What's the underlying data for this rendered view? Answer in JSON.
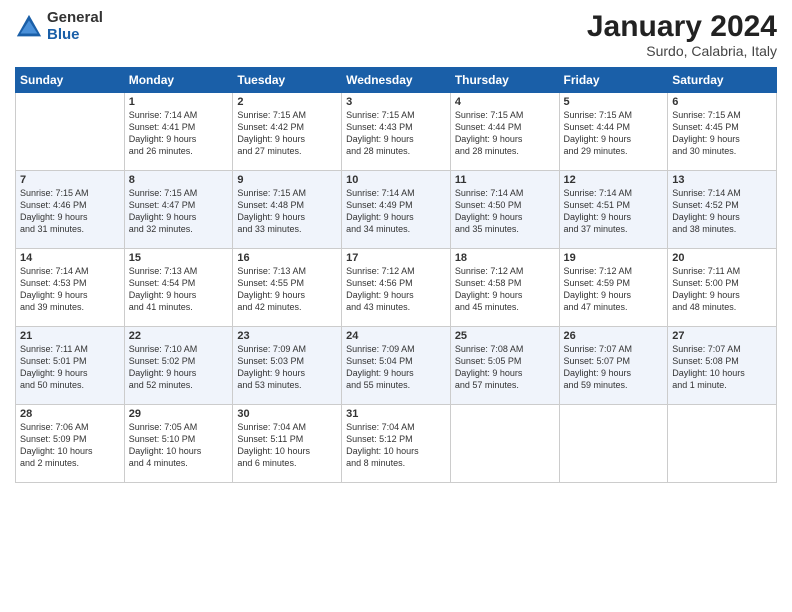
{
  "header": {
    "logo_general": "General",
    "logo_blue": "Blue",
    "title": "January 2024",
    "subtitle": "Surdo, Calabria, Italy"
  },
  "columns": [
    "Sunday",
    "Monday",
    "Tuesday",
    "Wednesday",
    "Thursday",
    "Friday",
    "Saturday"
  ],
  "weeks": [
    [
      {
        "day": "",
        "info": ""
      },
      {
        "day": "1",
        "info": "Sunrise: 7:14 AM\nSunset: 4:41 PM\nDaylight: 9 hours\nand 26 minutes."
      },
      {
        "day": "2",
        "info": "Sunrise: 7:15 AM\nSunset: 4:42 PM\nDaylight: 9 hours\nand 27 minutes."
      },
      {
        "day": "3",
        "info": "Sunrise: 7:15 AM\nSunset: 4:43 PM\nDaylight: 9 hours\nand 28 minutes."
      },
      {
        "day": "4",
        "info": "Sunrise: 7:15 AM\nSunset: 4:44 PM\nDaylight: 9 hours\nand 28 minutes."
      },
      {
        "day": "5",
        "info": "Sunrise: 7:15 AM\nSunset: 4:44 PM\nDaylight: 9 hours\nand 29 minutes."
      },
      {
        "day": "6",
        "info": "Sunrise: 7:15 AM\nSunset: 4:45 PM\nDaylight: 9 hours\nand 30 minutes."
      }
    ],
    [
      {
        "day": "7",
        "info": "Sunrise: 7:15 AM\nSunset: 4:46 PM\nDaylight: 9 hours\nand 31 minutes."
      },
      {
        "day": "8",
        "info": "Sunrise: 7:15 AM\nSunset: 4:47 PM\nDaylight: 9 hours\nand 32 minutes."
      },
      {
        "day": "9",
        "info": "Sunrise: 7:15 AM\nSunset: 4:48 PM\nDaylight: 9 hours\nand 33 minutes."
      },
      {
        "day": "10",
        "info": "Sunrise: 7:14 AM\nSunset: 4:49 PM\nDaylight: 9 hours\nand 34 minutes."
      },
      {
        "day": "11",
        "info": "Sunrise: 7:14 AM\nSunset: 4:50 PM\nDaylight: 9 hours\nand 35 minutes."
      },
      {
        "day": "12",
        "info": "Sunrise: 7:14 AM\nSunset: 4:51 PM\nDaylight: 9 hours\nand 37 minutes."
      },
      {
        "day": "13",
        "info": "Sunrise: 7:14 AM\nSunset: 4:52 PM\nDaylight: 9 hours\nand 38 minutes."
      }
    ],
    [
      {
        "day": "14",
        "info": "Sunrise: 7:14 AM\nSunset: 4:53 PM\nDaylight: 9 hours\nand 39 minutes."
      },
      {
        "day": "15",
        "info": "Sunrise: 7:13 AM\nSunset: 4:54 PM\nDaylight: 9 hours\nand 41 minutes."
      },
      {
        "day": "16",
        "info": "Sunrise: 7:13 AM\nSunset: 4:55 PM\nDaylight: 9 hours\nand 42 minutes."
      },
      {
        "day": "17",
        "info": "Sunrise: 7:12 AM\nSunset: 4:56 PM\nDaylight: 9 hours\nand 43 minutes."
      },
      {
        "day": "18",
        "info": "Sunrise: 7:12 AM\nSunset: 4:58 PM\nDaylight: 9 hours\nand 45 minutes."
      },
      {
        "day": "19",
        "info": "Sunrise: 7:12 AM\nSunset: 4:59 PM\nDaylight: 9 hours\nand 47 minutes."
      },
      {
        "day": "20",
        "info": "Sunrise: 7:11 AM\nSunset: 5:00 PM\nDaylight: 9 hours\nand 48 minutes."
      }
    ],
    [
      {
        "day": "21",
        "info": "Sunrise: 7:11 AM\nSunset: 5:01 PM\nDaylight: 9 hours\nand 50 minutes."
      },
      {
        "day": "22",
        "info": "Sunrise: 7:10 AM\nSunset: 5:02 PM\nDaylight: 9 hours\nand 52 minutes."
      },
      {
        "day": "23",
        "info": "Sunrise: 7:09 AM\nSunset: 5:03 PM\nDaylight: 9 hours\nand 53 minutes."
      },
      {
        "day": "24",
        "info": "Sunrise: 7:09 AM\nSunset: 5:04 PM\nDaylight: 9 hours\nand 55 minutes."
      },
      {
        "day": "25",
        "info": "Sunrise: 7:08 AM\nSunset: 5:05 PM\nDaylight: 9 hours\nand 57 minutes."
      },
      {
        "day": "26",
        "info": "Sunrise: 7:07 AM\nSunset: 5:07 PM\nDaylight: 9 hours\nand 59 minutes."
      },
      {
        "day": "27",
        "info": "Sunrise: 7:07 AM\nSunset: 5:08 PM\nDaylight: 10 hours\nand 1 minute."
      }
    ],
    [
      {
        "day": "28",
        "info": "Sunrise: 7:06 AM\nSunset: 5:09 PM\nDaylight: 10 hours\nand 2 minutes."
      },
      {
        "day": "29",
        "info": "Sunrise: 7:05 AM\nSunset: 5:10 PM\nDaylight: 10 hours\nand 4 minutes."
      },
      {
        "day": "30",
        "info": "Sunrise: 7:04 AM\nSunset: 5:11 PM\nDaylight: 10 hours\nand 6 minutes."
      },
      {
        "day": "31",
        "info": "Sunrise: 7:04 AM\nSunset: 5:12 PM\nDaylight: 10 hours\nand 8 minutes."
      },
      {
        "day": "",
        "info": ""
      },
      {
        "day": "",
        "info": ""
      },
      {
        "day": "",
        "info": ""
      }
    ]
  ]
}
